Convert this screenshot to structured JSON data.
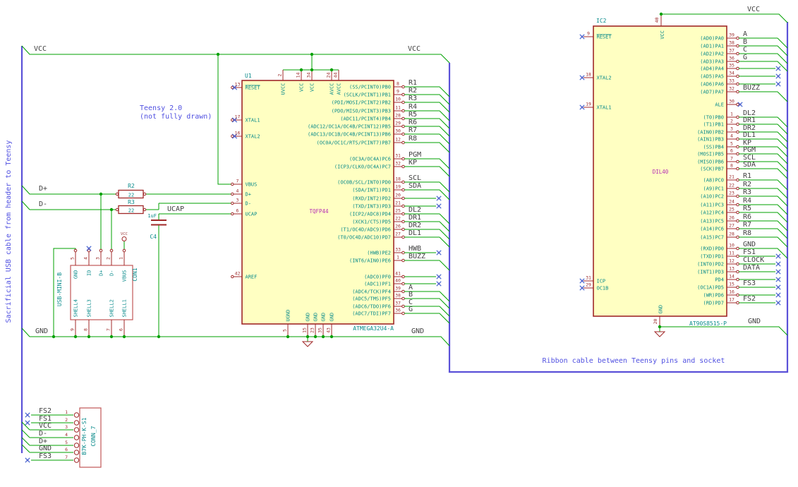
{
  "colors": {
    "wire_green": "#00a000",
    "bus_blue": "#5b51d8",
    "outline_red": "#a02828",
    "ic_body_fill": "#ffffc2",
    "pin_name_teal": "#0a8b8b",
    "value_magenta": "#b52cb5",
    "net_label_gray": "#3f3f3f",
    "note_blue": "#5151e1",
    "no_connect_blue": "#4668cf"
  },
  "notes": {
    "sacrificial": "Sacrificial USB cable from header to Teensy",
    "teensy_1": "Teensy 2.0",
    "teensy_2": "(not fully drawn)",
    "ribbon": "Ribbon cable between Teensy pins and socket"
  },
  "labels": {
    "vcc": "VCC",
    "gnd": "GND",
    "dplus": "D+",
    "dminus": "D-",
    "ucap": "UCAP"
  },
  "u1": {
    "ref": "U1",
    "value": "ATMEGA32U4-A",
    "footprint": "TQFP44",
    "left_pins": [
      {
        "n": "13",
        "name": "RESET",
        "ov": true
      },
      {
        "n": "17",
        "name": "XTAL1"
      },
      {
        "n": "16",
        "name": "XTAL2"
      },
      {
        "n": "7",
        "name": "VBUS"
      },
      {
        "n": "4",
        "name": "D+"
      },
      {
        "n": "3",
        "name": "D-"
      },
      {
        "n": "6",
        "name": "UCAP"
      },
      {
        "n": "42",
        "name": "AREF"
      }
    ],
    "top_pins": [
      {
        "n": "2",
        "name": "UVCC"
      },
      {
        "n": "14",
        "name": "VCC"
      },
      {
        "n": "34",
        "name": "VCC"
      },
      {
        "n": "24",
        "name": "AVCC"
      },
      {
        "n": "44",
        "name": "AVCC"
      }
    ],
    "bottom_pins": [
      {
        "n": "5",
        "name": "UGND"
      },
      {
        "n": "15",
        "name": "GND"
      },
      {
        "n": "23",
        "name": "GND"
      },
      {
        "n": "35",
        "name": "GND"
      },
      {
        "n": "43",
        "name": "GND"
      }
    ],
    "right_pins": [
      {
        "n": "8",
        "name": "(SS/PCINT0)PB0",
        "label": "R1"
      },
      {
        "n": "9",
        "name": "(SCLK/PCINT1)PB1",
        "label": "R2"
      },
      {
        "n": "10",
        "name": "(PDI/MOSI/PCINT2)PB2",
        "label": "R3"
      },
      {
        "n": "11",
        "name": "(PDO/MISO/PCINT3)PB3",
        "label": "R4"
      },
      {
        "n": "28",
        "name": "(ADC11/PCINT4)PB4",
        "label": "R5"
      },
      {
        "n": "29",
        "name": "(ADC12/OC1A/OC4B/PCINT12)PB5",
        "label": "R6"
      },
      {
        "n": "30",
        "name": "(ADC13/OC1B/OC4B/PCINT13)PB6",
        "label": "R7"
      },
      {
        "n": "12",
        "name": "(OC0A/OC1C/RTS/PCINT7)PB7",
        "label": "R8"
      },
      {
        "n": "31",
        "name": "(OC3A/OC4A)PC6",
        "label": "PGM"
      },
      {
        "n": "32",
        "name": "(ICP3/CLK0/OC4A)PC7",
        "label": "KP"
      },
      {
        "n": "18",
        "name": "(OC0B/SCL/INT0)PD0",
        "label": "SCL"
      },
      {
        "n": "19",
        "name": "(SDA/INT1)PD1",
        "label": "SDA"
      },
      {
        "n": "20",
        "name": "(RXD/INT2)PD2",
        "label": null
      },
      {
        "n": "21",
        "name": "(TXD/INT3)PD3",
        "label": null
      },
      {
        "n": "25",
        "name": "(ICP2/ADC8)PD4",
        "label": "DL2"
      },
      {
        "n": "22",
        "name": "(XCK1/CTS)PD5",
        "label": "DR1"
      },
      {
        "n": "26",
        "name": "(T1/OC4D/ADC9)PD6",
        "label": "DR2"
      },
      {
        "n": "27",
        "name": "(T0/OC4D/ADC10)PD7",
        "label": "DL1"
      },
      {
        "n": "33",
        "name": "(HWB)PE2",
        "label": "HWB"
      },
      {
        "n": "1",
        "name": "(INT6/AIN0)PE6",
        "label": "BUZZ"
      },
      {
        "n": "41",
        "name": "(ADC0)PF0",
        "label": null
      },
      {
        "n": "40",
        "name": "(ADC1)PF1",
        "label": null
      },
      {
        "n": "39",
        "name": "(ADC4/TCK)PF4",
        "label": "A"
      },
      {
        "n": "38",
        "name": "(ADC5/TMS)PF5",
        "label": "B"
      },
      {
        "n": "37",
        "name": "(ADC6/TDO)PF6",
        "label": "C"
      },
      {
        "n": "36",
        "name": "(ADC7/TDI)PF7",
        "label": "G"
      }
    ]
  },
  "ic2": {
    "ref": "IC2",
    "value": "AT90S8515-P",
    "footprint": "DIL40",
    "left_pins": [
      {
        "n": "9",
        "name": "RESET",
        "ov": true
      },
      {
        "n": "18",
        "name": "XTAL2"
      },
      {
        "n": "19",
        "name": "XTAL1"
      },
      {
        "n": "31",
        "name": "ICP"
      },
      {
        "n": "29",
        "name": "OC1B"
      }
    ],
    "top_pins": [
      {
        "n": "40",
        "name": "VCC"
      }
    ],
    "bottom_pins": [
      {
        "n": "20",
        "name": "GND"
      }
    ],
    "right_pins": [
      {
        "n": "39",
        "name": "(AD0)PA0",
        "label": "A"
      },
      {
        "n": "38",
        "name": "(AD1)PA1",
        "label": "B"
      },
      {
        "n": "37",
        "name": "(AD2)PA2",
        "label": "C"
      },
      {
        "n": "36",
        "name": "(AD3)PA3",
        "label": "G"
      },
      {
        "n": "35",
        "name": "(AD4)PA4",
        "label": null
      },
      {
        "n": "34",
        "name": "(AD5)PA5",
        "label": null
      },
      {
        "n": "33",
        "name": "(AD6)PA6",
        "label": null
      },
      {
        "n": "32",
        "name": "(AD7)PA7",
        "label": "BUZZ"
      },
      {
        "n": "30",
        "name": "ALE",
        "label": null
      },
      {
        "n": "1",
        "name": "(T0)PB0",
        "label": "DL2"
      },
      {
        "n": "2",
        "name": "(T1)PB1",
        "label": "DR1"
      },
      {
        "n": "3",
        "name": "(AIN0)PB2",
        "label": "DR2"
      },
      {
        "n": "4",
        "name": "(AIN1)PB3",
        "label": "DL1"
      },
      {
        "n": "5",
        "name": "(SS)PB4",
        "label": "KP"
      },
      {
        "n": "6",
        "name": "(MOSI)PB5",
        "label": "PGM"
      },
      {
        "n": "7",
        "name": "(MISO)PB6",
        "label": "SCL"
      },
      {
        "n": "8",
        "name": "(SCK)PB7",
        "label": "SDA"
      },
      {
        "n": "21",
        "name": "(A8)PC0",
        "label": "R1"
      },
      {
        "n": "22",
        "name": "(A9)PC1",
        "label": "R2"
      },
      {
        "n": "23",
        "name": "(A10)PC2",
        "label": "R3"
      },
      {
        "n": "24",
        "name": "(A11)PC3",
        "label": "R4"
      },
      {
        "n": "25",
        "name": "(A12)PC4",
        "label": "R5"
      },
      {
        "n": "26",
        "name": "(A13)PC5",
        "label": "R6"
      },
      {
        "n": "27",
        "name": "(A14)PC6",
        "label": "R7"
      },
      {
        "n": "28",
        "name": "(A15)PC7",
        "label": "R8"
      },
      {
        "n": "10",
        "name": "(RXD)PD0",
        "label": "GND"
      },
      {
        "n": "11",
        "name": "(TXD)PD1",
        "label": "FS1"
      },
      {
        "n": "12",
        "name": "(INT0)PD2",
        "label": "CLOCK"
      },
      {
        "n": "13",
        "name": "(INT1)PD3",
        "label": "DATA"
      },
      {
        "n": "14",
        "name": "PD4",
        "label": null
      },
      {
        "n": "15",
        "name": "(OC1A)PD5",
        "label": "FS3"
      },
      {
        "n": "16",
        "name": "(WR)PD6",
        "label": null
      },
      {
        "n": "17",
        "name": "(RD)PD7",
        "label": "FS2"
      }
    ]
  },
  "con1": {
    "ref": "CON1",
    "value": "USB-MINI-B",
    "top_pins": [
      {
        "n": "5",
        "name": "GND"
      },
      {
        "n": "4",
        "name": "ID"
      },
      {
        "n": "3",
        "name": "D+"
      },
      {
        "n": "2",
        "name": "D-"
      },
      {
        "n": "1",
        "name": "VBUS"
      }
    ],
    "bottom_pins": [
      {
        "n": "9",
        "name": "SHELL4"
      },
      {
        "n": "8",
        "name": "SHELL3"
      },
      {
        "n": "7",
        "name": "SHELL2"
      },
      {
        "n": "6",
        "name": "SHELL1"
      }
    ]
  },
  "conn7": {
    "ref": "CONN_7",
    "value": "B7K-PH-K-S1",
    "pins": [
      {
        "n": "1",
        "label": "FS2"
      },
      {
        "n": "2",
        "label": "FS1"
      },
      {
        "n": "3",
        "label": "VCC"
      },
      {
        "n": "4",
        "label": "D-"
      },
      {
        "n": "5",
        "label": "D+"
      },
      {
        "n": "6",
        "label": "GND"
      },
      {
        "n": "7",
        "label": "FS3"
      }
    ]
  },
  "r2": {
    "ref": "R2",
    "value": "22"
  },
  "r3": {
    "ref": "R3",
    "value": "22"
  },
  "c4": {
    "ref": "C4",
    "value": "1uF"
  }
}
